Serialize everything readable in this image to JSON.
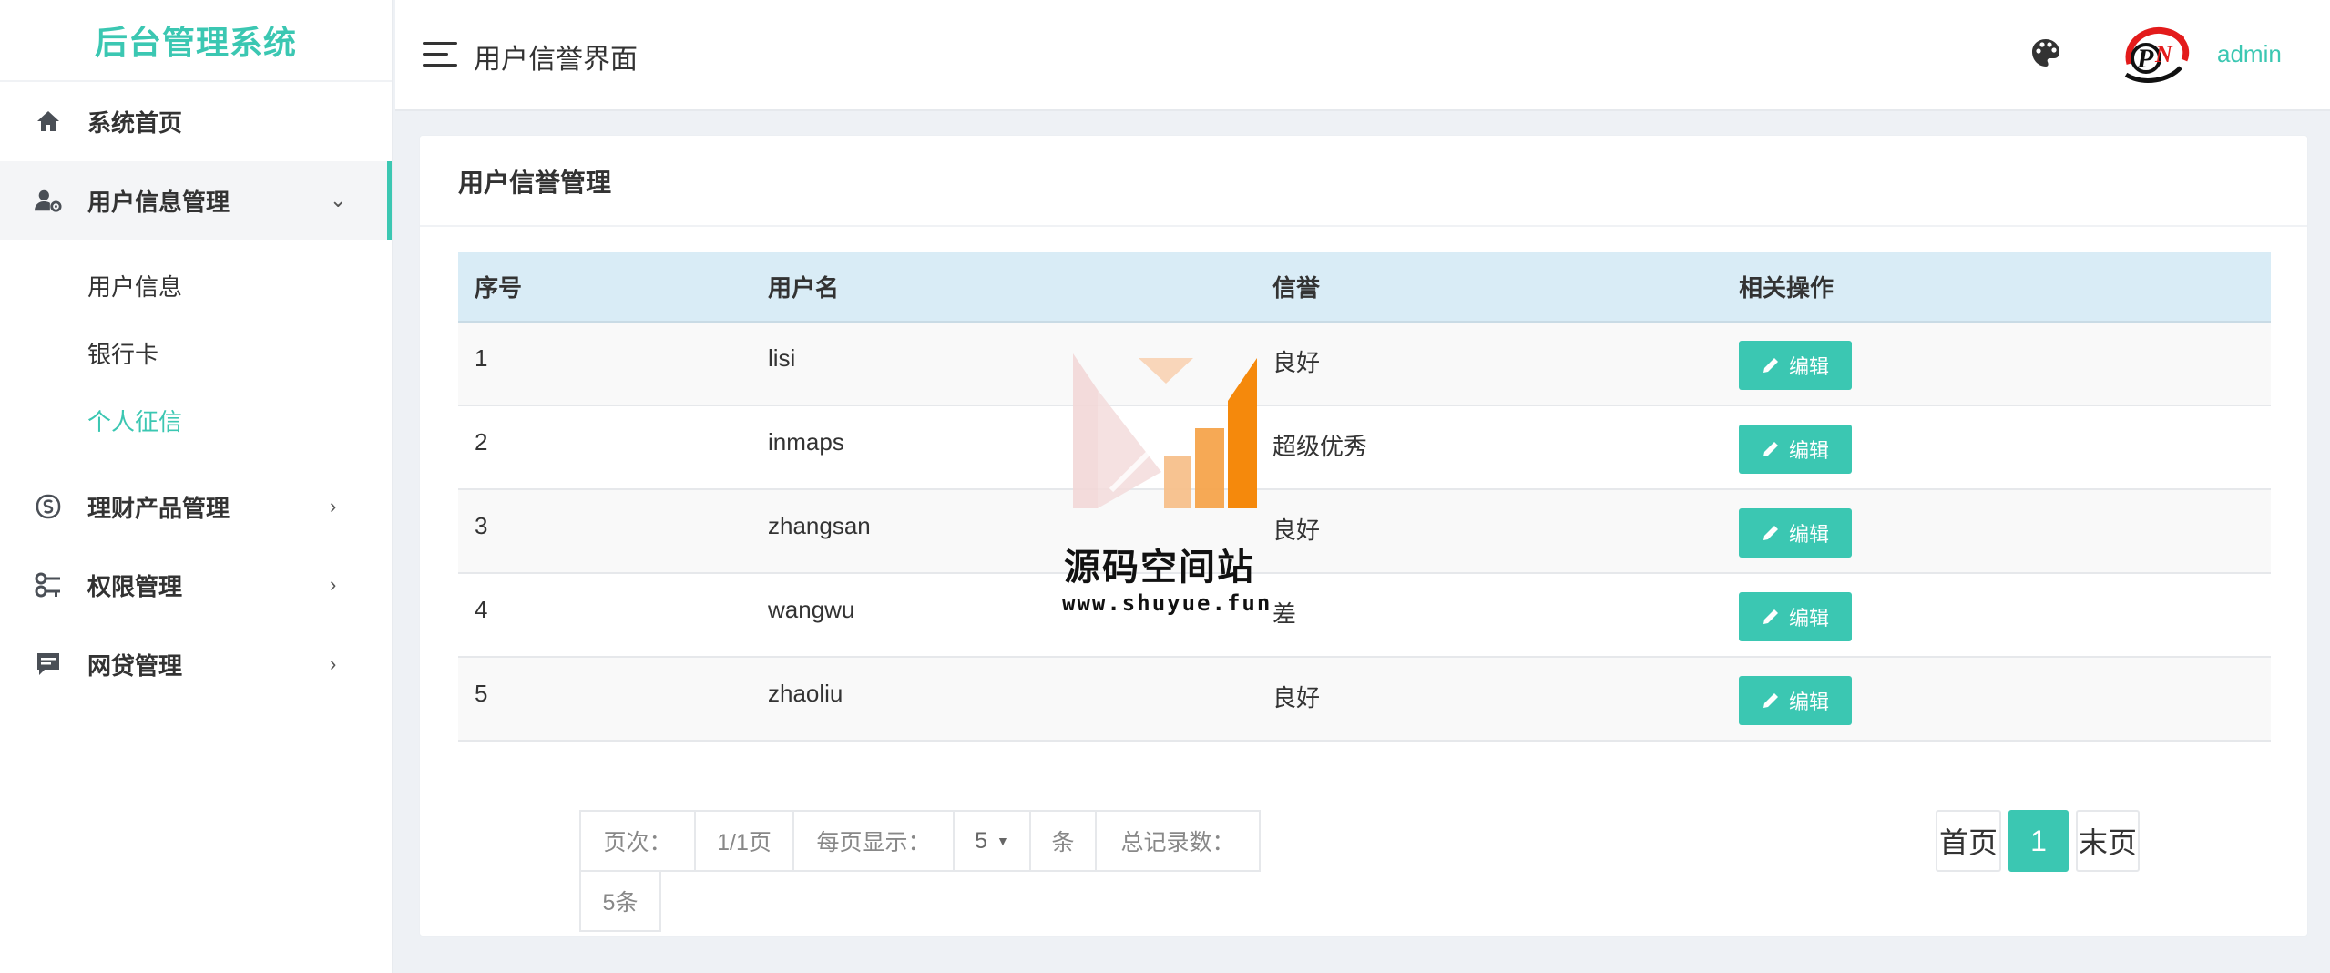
{
  "brand": {
    "title": "后台管理系统"
  },
  "sidebar": {
    "items": [
      {
        "label": "系统首页",
        "icon": "home-icon"
      },
      {
        "label": "用户信息管理",
        "icon": "user-gear-icon",
        "arrow": "⌄"
      },
      {
        "label": "理财产品管理",
        "icon": "finance-icon",
        "arrow": "›"
      },
      {
        "label": "权限管理",
        "icon": "key-icon",
        "arrow": "›"
      },
      {
        "label": "网贷管理",
        "icon": "message-icon",
        "arrow": "›"
      }
    ],
    "sub_items": [
      {
        "label": "用户信息"
      },
      {
        "label": "银行卡"
      },
      {
        "label": "个人征信"
      }
    ]
  },
  "header": {
    "title": "用户信誉界面",
    "user": "admin"
  },
  "card": {
    "title": "用户信誉管理",
    "columns": [
      "序号",
      "用户名",
      "信誉",
      "相关操作"
    ],
    "edit_label": "编辑",
    "rows": [
      {
        "no": "1",
        "username": "lisi",
        "credit": "良好"
      },
      {
        "no": "2",
        "username": "inmaps",
        "credit": "超级优秀"
      },
      {
        "no": "3",
        "username": "zhangsan",
        "credit": "良好"
      },
      {
        "no": "4",
        "username": "wangwu",
        "credit": "差"
      },
      {
        "no": "5",
        "username": "zhaoliu",
        "credit": "良好"
      }
    ]
  },
  "pagination": {
    "page_label": "页次：",
    "page_value": "1/1页",
    "per_page_label": "每页显示：",
    "per_page_value": "5",
    "unit": "条",
    "total_label": "总记录数：",
    "total_value": "5条",
    "first": "首页",
    "current": "1",
    "last": "末页"
  },
  "watermark": {
    "name": "源码空间站",
    "url": "www.shuyue.fun"
  },
  "colors": {
    "accent": "#3bc7b2",
    "table_header": "#d9ecf6",
    "watermark_orange": "#f5890c"
  }
}
